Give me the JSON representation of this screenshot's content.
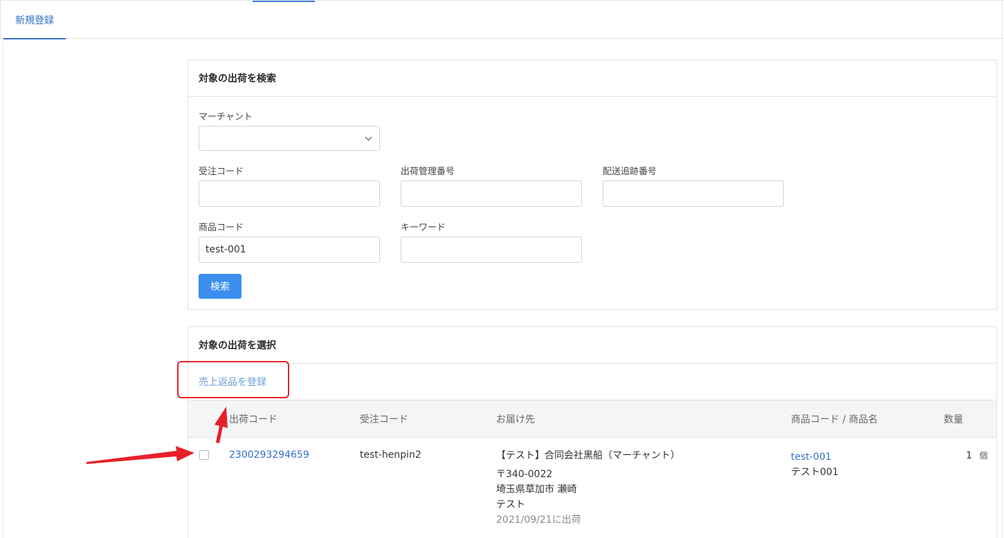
{
  "tabs": {
    "active_label": "新規登録"
  },
  "search_card": {
    "title": "対象の出荷を検索",
    "merchant_label": "マーチャント",
    "merchant_value": "",
    "order_code_label": "受注コード",
    "order_code_value": "",
    "shipment_number_label": "出荷管理番号",
    "shipment_number_value": "",
    "tracking_number_label": "配送追跡番号",
    "tracking_number_value": "",
    "product_code_label": "商品コード",
    "product_code_value": "test-001",
    "keyword_label": "キーワード",
    "keyword_value": "",
    "search_button": "検索"
  },
  "select_card": {
    "title": "対象の出荷を選択",
    "register_link": "売上返品を登録",
    "columns": {
      "shipment_code": "出荷コード",
      "order_code": "受注コード",
      "destination": "お届け先",
      "product": "商品コード / 商品名",
      "quantity": "数量"
    },
    "rows": [
      {
        "shipment_code": "2300293294659",
        "order_code": "test-henpin2",
        "recipient": "【テスト】合同会社黒船（マーチャント）",
        "postal": "〒340-0022",
        "address": "埼玉県草加市 瀬崎",
        "address2": "テスト",
        "shipped": "2021/09/21に出荷",
        "product_code": "test-001",
        "product_name": "テスト001",
        "quantity": "1",
        "unit": "個"
      }
    ]
  },
  "annotation": {
    "color": "#e8202a"
  },
  "colors": {
    "primary": "#3b8eed",
    "link": "#2f6fc9"
  }
}
